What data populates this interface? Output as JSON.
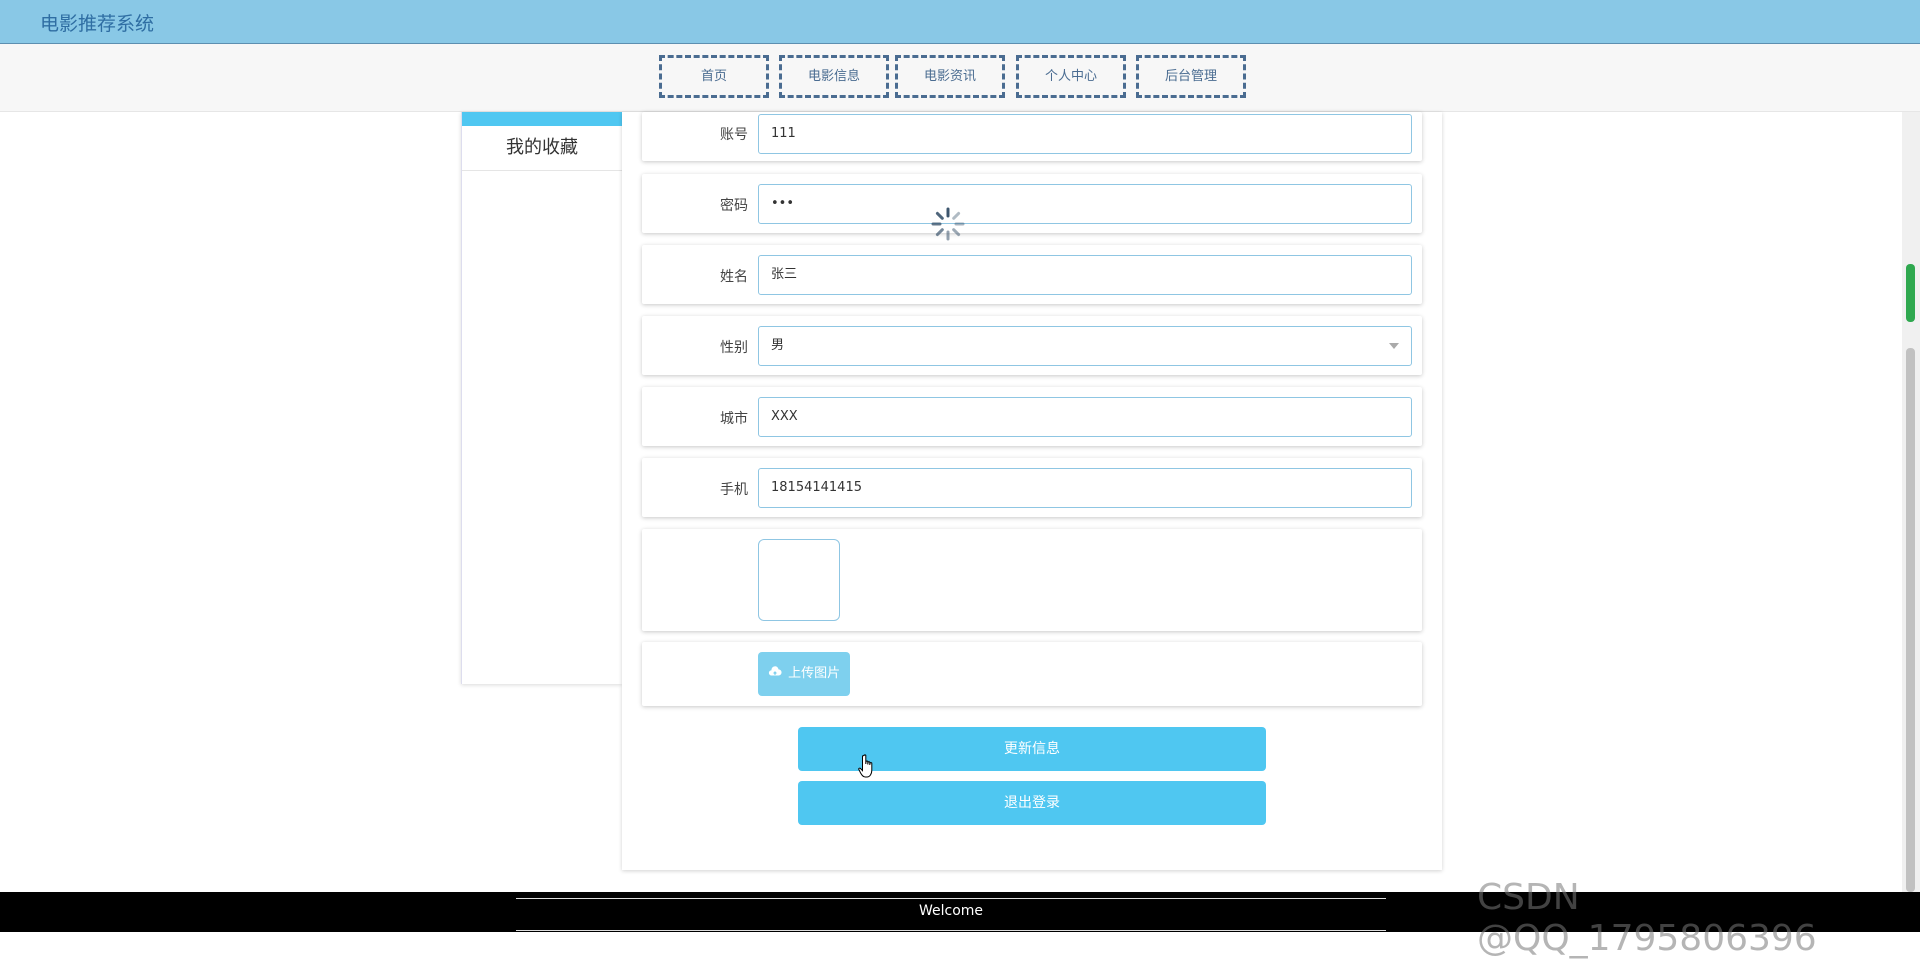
{
  "header": {
    "title": "电影推荐系统"
  },
  "nav": {
    "items": [
      {
        "label": "首页"
      },
      {
        "label": "电影信息"
      },
      {
        "label": "电影资讯"
      },
      {
        "label": "个人中心"
      },
      {
        "label": "后台管理"
      }
    ]
  },
  "sidebar": {
    "items": [
      {
        "label": "我的收藏"
      }
    ]
  },
  "form": {
    "account": {
      "label": "账号",
      "value": "111"
    },
    "password": {
      "label": "密码",
      "value": "•••"
    },
    "name": {
      "label": "姓名",
      "value": "张三"
    },
    "gender": {
      "label": "性别",
      "value": "男"
    },
    "city": {
      "label": "城市",
      "value": "XXX"
    },
    "phone": {
      "label": "手机",
      "value": "18154141415"
    },
    "upload_label": "上传图片",
    "update_label": "更新信息",
    "logout_label": "退出登录"
  },
  "footer": {
    "text": "Welcome"
  },
  "watermark": "CSDN @QQ_1795806396",
  "colors": {
    "header_bg": "#89c8e6",
    "accent": "#4fc7f1",
    "nav_border": "#4a6c91",
    "footer_bg": "#000000"
  }
}
